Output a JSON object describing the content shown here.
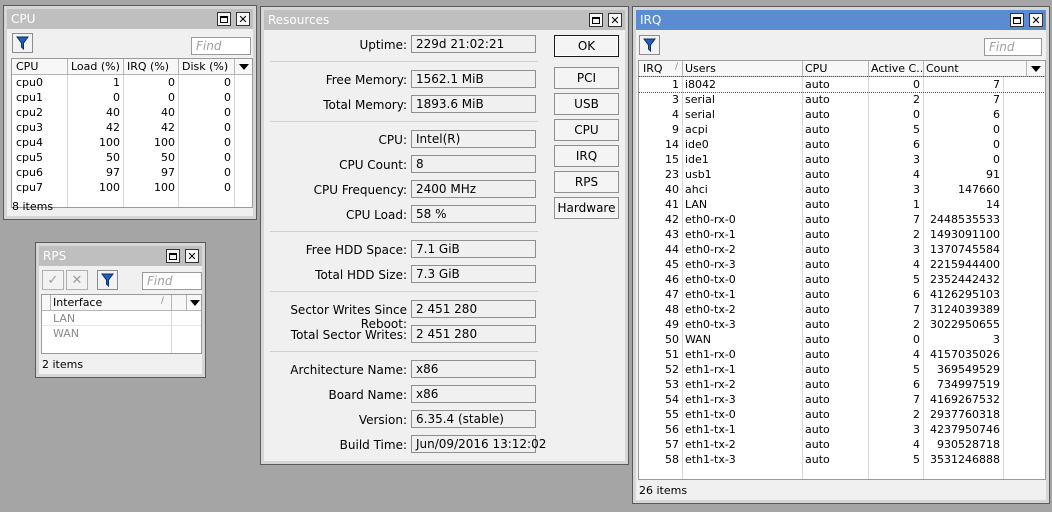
{
  "cpu_window": {
    "title": "CPU",
    "find_placeholder": "Find",
    "columns": [
      "CPU",
      "Load (%)",
      "IRQ (%)",
      "Disk (%)"
    ],
    "rows": [
      [
        "cpu0",
        "1",
        "0",
        "0"
      ],
      [
        "cpu1",
        "0",
        "0",
        "0"
      ],
      [
        "cpu2",
        "40",
        "40",
        "0"
      ],
      [
        "cpu3",
        "42",
        "42",
        "0"
      ],
      [
        "cpu4",
        "100",
        "100",
        "0"
      ],
      [
        "cpu5",
        "50",
        "50",
        "0"
      ],
      [
        "cpu6",
        "97",
        "97",
        "0"
      ],
      [
        "cpu7",
        "100",
        "100",
        "0"
      ]
    ],
    "status": "8 items"
  },
  "rps_window": {
    "title": "RPS",
    "find_placeholder": "Find",
    "columns": [
      "Interface"
    ],
    "rows": [
      "LAN",
      "WAN"
    ],
    "status": "2 items"
  },
  "resources_window": {
    "title": "Resources",
    "fields": [
      {
        "label": "Uptime:",
        "value": "229d 21:02:21"
      },
      {
        "label": "Free Memory:",
        "value": "1562.1 MiB"
      },
      {
        "label": "Total Memory:",
        "value": "1893.6 MiB"
      },
      {
        "label": "CPU:",
        "value": "Intel(R)"
      },
      {
        "label": "CPU Count:",
        "value": "8"
      },
      {
        "label": "CPU Frequency:",
        "value": "2400 MHz"
      },
      {
        "label": "CPU Load:",
        "value": "58 %"
      },
      {
        "label": "Free HDD Space:",
        "value": "7.1 GiB"
      },
      {
        "label": "Total HDD Size:",
        "value": "7.3 GiB"
      },
      {
        "label": "Sector Writes Since Reboot:",
        "value": "2 451 280"
      },
      {
        "label": "Total Sector Writes:",
        "value": "2 451 280"
      },
      {
        "label": "Architecture Name:",
        "value": "x86"
      },
      {
        "label": "Board Name:",
        "value": "x86"
      },
      {
        "label": "Version:",
        "value": "6.35.4 (stable)"
      },
      {
        "label": "Build Time:",
        "value": "Jun/09/2016 13:12:02"
      }
    ],
    "buttons": [
      "OK",
      "PCI",
      "USB",
      "CPU",
      "IRQ",
      "RPS",
      "Hardware"
    ]
  },
  "irq_window": {
    "title": "IRQ",
    "find_placeholder": "Find",
    "columns": [
      "IRQ",
      "Users",
      "CPU",
      "Active C...",
      "Count"
    ],
    "rows": [
      [
        "1",
        "i8042",
        "auto",
        "0",
        "7"
      ],
      [
        "3",
        "serial",
        "auto",
        "2",
        "7"
      ],
      [
        "4",
        "serial",
        "auto",
        "0",
        "6"
      ],
      [
        "9",
        "acpi",
        "auto",
        "5",
        "0"
      ],
      [
        "14",
        "ide0",
        "auto",
        "6",
        "0"
      ],
      [
        "15",
        "ide1",
        "auto",
        "3",
        "0"
      ],
      [
        "23",
        "usb1",
        "auto",
        "4",
        "91"
      ],
      [
        "40",
        "ahci",
        "auto",
        "3",
        "147660"
      ],
      [
        "41",
        "LAN",
        "auto",
        "1",
        "14"
      ],
      [
        "42",
        "eth0-rx-0",
        "auto",
        "7",
        "2448535533"
      ],
      [
        "43",
        "eth0-rx-1",
        "auto",
        "2",
        "1493091100"
      ],
      [
        "44",
        "eth0-rx-2",
        "auto",
        "3",
        "1370745584"
      ],
      [
        "45",
        "eth0-rx-3",
        "auto",
        "4",
        "2215944400"
      ],
      [
        "46",
        "eth0-tx-0",
        "auto",
        "5",
        "2352442432"
      ],
      [
        "47",
        "eth0-tx-1",
        "auto",
        "6",
        "4126295103"
      ],
      [
        "48",
        "eth0-tx-2",
        "auto",
        "7",
        "3124039389"
      ],
      [
        "49",
        "eth0-tx-3",
        "auto",
        "2",
        "3022950655"
      ],
      [
        "50",
        "WAN",
        "auto",
        "0",
        "3"
      ],
      [
        "51",
        "eth1-rx-0",
        "auto",
        "4",
        "4157035026"
      ],
      [
        "52",
        "eth1-rx-1",
        "auto",
        "5",
        "369549529"
      ],
      [
        "53",
        "eth1-rx-2",
        "auto",
        "6",
        "734997519"
      ],
      [
        "54",
        "eth1-rx-3",
        "auto",
        "7",
        "4169267532"
      ],
      [
        "55",
        "eth1-tx-0",
        "auto",
        "2",
        "2937760318"
      ],
      [
        "56",
        "eth1-tx-1",
        "auto",
        "3",
        "4237950746"
      ],
      [
        "57",
        "eth1-tx-2",
        "auto",
        "4",
        "930528718"
      ],
      [
        "58",
        "eth1-tx-3",
        "auto",
        "5",
        "3531246888"
      ]
    ],
    "status": "26 items"
  },
  "icons": {
    "filter": "filter-icon",
    "maximize": "maximize-icon",
    "close": "close-icon",
    "check": "check-icon",
    "cross": "cross-icon",
    "sort": "chevron-down-icon"
  },
  "colors": {
    "active_title": "#5b8bd0",
    "inactive_title": "#bfbfbf",
    "desktop": "#a5a5a5"
  }
}
